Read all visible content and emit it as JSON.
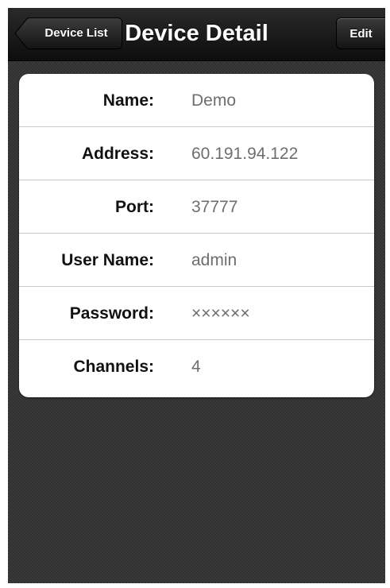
{
  "navbar": {
    "title": "Device Detail",
    "back_label": "Device List",
    "edit_label": "Edit"
  },
  "device": {
    "rows": [
      {
        "label": "Name:",
        "value": "Demo"
      },
      {
        "label": "Address:",
        "value": "60.191.94.122"
      },
      {
        "label": "Port:",
        "value": "37777"
      },
      {
        "label": "User Name:",
        "value": "admin"
      },
      {
        "label": "Password:",
        "value": "××××××"
      },
      {
        "label": "Channels:",
        "value": "4"
      }
    ]
  },
  "colors": {
    "navbar": "#111111",
    "background": "#3b3b3b",
    "value_text": "#6e6e6e"
  }
}
